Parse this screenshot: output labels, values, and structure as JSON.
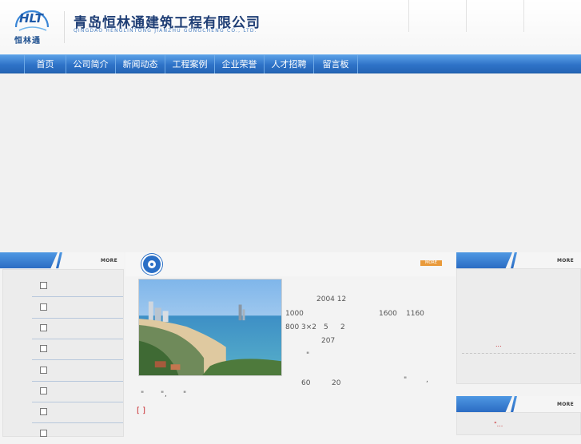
{
  "header": {
    "logo_letters": "HLT",
    "logo_name": "恒林通",
    "company_cn": "青岛恒林通建筑工程有限公司",
    "company_en": "QINGDAO HENGLINTONG JIANZHU GONGCHENG CO., LTD."
  },
  "nav": {
    "items": [
      {
        "label": "首页"
      },
      {
        "label": "公司简介"
      },
      {
        "label": "新闻动态"
      },
      {
        "label": "工程案例"
      },
      {
        "label": "企业荣誉"
      },
      {
        "label": "人才招聘"
      },
      {
        "label": "留言板"
      }
    ]
  },
  "left_panel": {
    "more_label": "MORE",
    "rows": 8
  },
  "center": {
    "more_label": "MORE",
    "text_lines": [
      "2004 12",
      "1000",
      "1600",
      "1160",
      "800  3×2",
      "5",
      "2",
      "207",
      "\"",
      "60",
      "20",
      "\"",
      ",",
      "\"",
      "\"",
      ",",
      "\""
    ],
    "more_link": "[ ]"
  },
  "right_panel": {
    "more_label_1": "MORE",
    "dots_1": "...",
    "more_label_2": "MORE",
    "dots_2": "\"..."
  },
  "colors": {
    "nav_blue": "#2f73c8",
    "brand_blue": "#1f3e75",
    "accent_orange": "#e99a3b",
    "link_red": "#c8282c"
  }
}
